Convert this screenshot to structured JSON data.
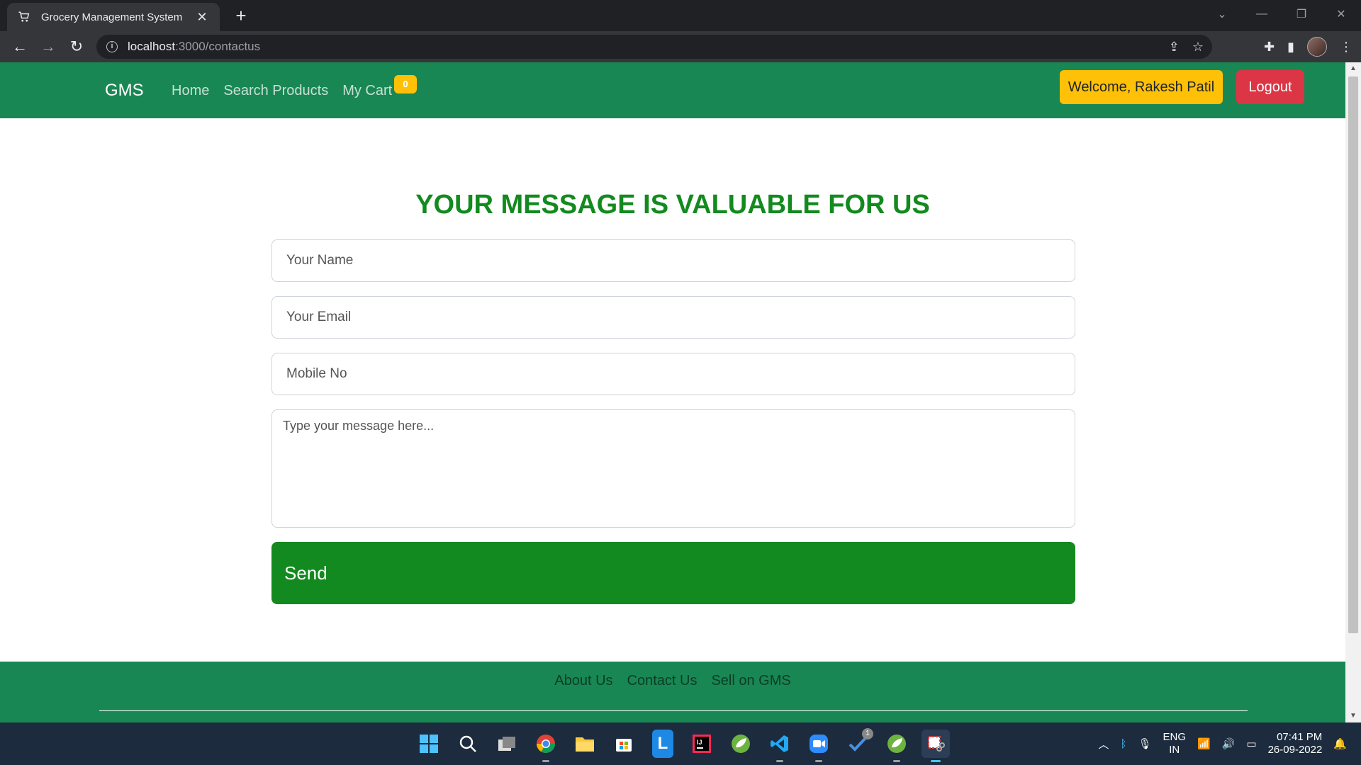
{
  "browser": {
    "tab_title": "Grocery Management System",
    "tab_close": "✕",
    "new_tab": "+",
    "url_host": "localhost",
    "url_path": ":3000/contactus"
  },
  "navbar": {
    "brand": "GMS",
    "links": [
      "Home",
      "Search Products",
      "My Cart"
    ],
    "cart_count": "0",
    "welcome_label": "Welcome, Rakesh Patil",
    "logout_label": "Logout",
    "color": "#198754"
  },
  "form": {
    "heading": "YOUR MESSAGE IS VALUABLE FOR US",
    "name_placeholder": "Your Name",
    "email_placeholder": "Your Email",
    "mobile_placeholder": "Mobile No",
    "message_placeholder": "Type your message here...",
    "send_label": "Send",
    "accent": "#138a1f"
  },
  "footer": {
    "links": [
      "About Us",
      "Contact Us",
      "Sell on GMS"
    ]
  },
  "taskbar": {
    "lang_line1": "ENG",
    "lang_line2": "IN",
    "time": "07:41 PM",
    "date": "26-09-2022",
    "notification_count": "1"
  }
}
